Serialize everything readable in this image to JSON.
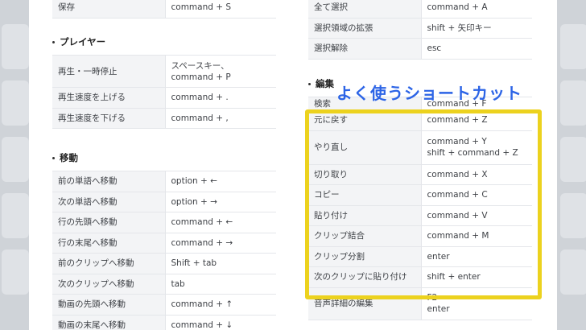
{
  "annotation": "よく使うショートカット",
  "left": {
    "top_rows": [
      {
        "k": "保存",
        "v": "command + S"
      }
    ],
    "player": {
      "title": "プレイヤー",
      "rows": [
        {
          "k": "再生・一時停止",
          "v": "スペースキー、command + P"
        },
        {
          "k": "再生速度を上げる",
          "v": "command + ."
        },
        {
          "k": "再生速度を下げる",
          "v": "command + ,"
        }
      ]
    },
    "move": {
      "title": "移動",
      "rows": [
        {
          "k": "前の単語へ移動",
          "v": "option + ←"
        },
        {
          "k": "次の単語へ移動",
          "v": "option + →"
        },
        {
          "k": "行の先頭へ移動",
          "v": "command + ←"
        },
        {
          "k": "行の末尾へ移動",
          "v": "command + →"
        },
        {
          "k": "前のクリップへ移動",
          "v": "Shift + tab"
        },
        {
          "k": "次のクリップへ移動",
          "v": "tab"
        },
        {
          "k": "動画の先頭へ移動",
          "v": "command + ↑"
        },
        {
          "k": "動画の末尾へ移動",
          "v": "command + ↓"
        }
      ]
    }
  },
  "right": {
    "top_rows": [
      {
        "k": "全て選択",
        "v": "command + A"
      },
      {
        "k": "選択領域の拡張",
        "v": "shift + 矢印キー"
      },
      {
        "k": "選択解除",
        "v": "esc"
      }
    ],
    "edit": {
      "title": "編集",
      "rows": [
        {
          "k": "検索",
          "v": "command + F"
        },
        {
          "k": "元に戻す",
          "v": "command + Z"
        },
        {
          "k": "やり直し",
          "v": "command + Y",
          "v2": "shift + command + Z"
        },
        {
          "k": "切り取り",
          "v": "command + X"
        },
        {
          "k": "コピー",
          "v": "command + C"
        },
        {
          "k": "貼り付け",
          "v": "command + V"
        },
        {
          "k": "クリップ結合",
          "v": "command + M"
        },
        {
          "k": "クリップ分割",
          "v": "enter"
        },
        {
          "k": "次のクリップに貼り付け",
          "v": "shift + enter"
        },
        {
          "k": "音声詳細の編集",
          "v": "F2",
          "v2": "enter"
        }
      ]
    }
  },
  "colors": {
    "highlight": "#ecd21e",
    "annotation": "#2c64e6"
  }
}
